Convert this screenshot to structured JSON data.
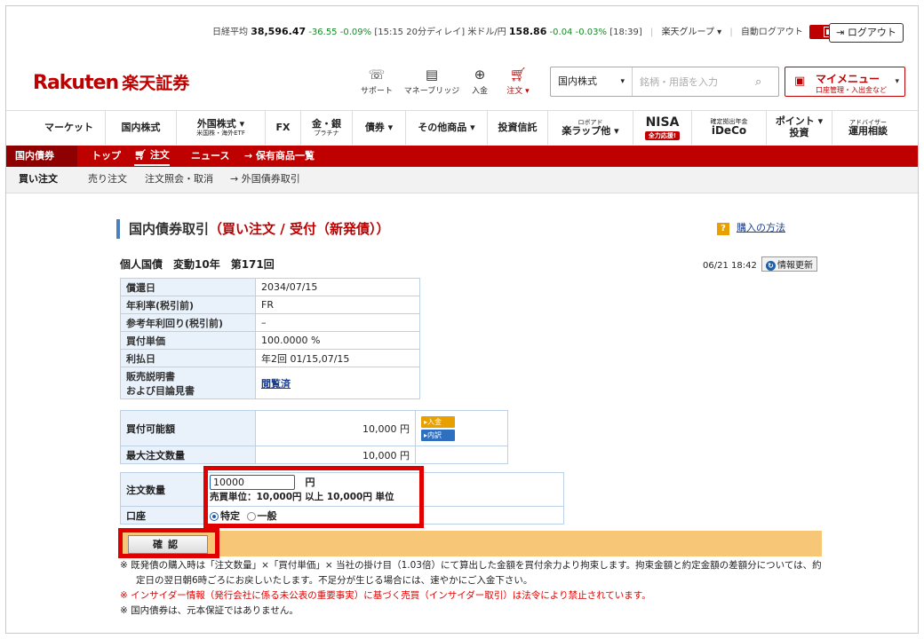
{
  "ticker": {
    "nikkei_label": "日経平均",
    "nikkei_value": "38,596.47",
    "nikkei_change": "-36.55",
    "nikkei_pct": "-0.09%",
    "nikkei_time": "[15:15 20分ディレイ]",
    "usd_label": "米ドル/円",
    "usd_value": "158.86",
    "usd_change": "-0.04",
    "usd_pct": "-0.03%",
    "usd_time": "[18:39]",
    "group": "楽天グループ",
    "auto_logout": "自動ログアウト",
    "logout": "ログアウト"
  },
  "header": {
    "logo_en": "Rakuten",
    "logo_jp": "楽天証券",
    "icons": [
      {
        "label": "サポート",
        "icon": "support-icon"
      },
      {
        "label": "マネーブリッジ",
        "icon": "bank-icon"
      },
      {
        "label": "入金",
        "icon": "deposit-icon"
      },
      {
        "label": "注文 ▾",
        "icon": "cart-icon"
      }
    ],
    "search_category": "国内株式",
    "search_placeholder": "銘柄・用語を入力",
    "mymenu_title": "マイメニュー",
    "mymenu_sub": "口座管理・入出金など"
  },
  "gnav": [
    {
      "label": "マーケット",
      "sub": ""
    },
    {
      "label": "国内株式",
      "sub": ""
    },
    {
      "label": "外国株式 ▾",
      "sub": "米国株・海外ETF"
    },
    {
      "label": "FX",
      "sub": ""
    },
    {
      "label": "金・銀",
      "sub": "プラチナ"
    },
    {
      "label": "債券 ▾",
      "sub": ""
    },
    {
      "label": "その他商品 ▾",
      "sub": ""
    },
    {
      "label": "投資信託",
      "sub": ""
    },
    {
      "label": "楽ラップ他 ▾",
      "sub": "ロボアド"
    },
    {
      "label": "NISA",
      "sub": "全力応援!"
    },
    {
      "label": "iDeCo",
      "sub": "確定拠出年金"
    },
    {
      "label": "ポイント ▾",
      "sub": "投資"
    },
    {
      "label": "アドバイザー",
      "sub": "運用相談"
    }
  ],
  "rednav": {
    "current": "国内債券",
    "top": "トップ",
    "order": "注文",
    "news": "ニュース",
    "holdings": "→ 保有商品一覧"
  },
  "subnav": {
    "buy": "買い注文",
    "sell": "売り注文",
    "inquiry": "注文照会・取消",
    "foreign": "→ 外国債券取引"
  },
  "page": {
    "title_main": "国内債券取引",
    "title_red": "（買い注文 / 受付（新発債））",
    "howto_mark": "?",
    "howto": "購入の方法",
    "bond_name": "個人国債　変動10年　第171回",
    "timestamp": "06/21 18:42",
    "refresh": "情報更新"
  },
  "info": [
    {
      "key": "償還日",
      "value": "2034/07/15"
    },
    {
      "key": "年利率(税引前)",
      "value": "FR"
    },
    {
      "key": "参考年利回り(税引前)",
      "value": "–"
    },
    {
      "key": "買付単価",
      "value": "100.0000 %"
    },
    {
      "key": "利払日",
      "value": "年2回 01/15,07/15"
    }
  ],
  "prospectus": {
    "key_line1": "販売説明書",
    "key_line2": "および目論見書",
    "value": "閲覧済"
  },
  "balance": {
    "available_label": "買付可能額",
    "available_value": "10,000 円",
    "deposit_btn": "▸入金",
    "detail_btn": "▸内訳",
    "max_label": "最大注文数量",
    "max_value": "10,000 円"
  },
  "order": {
    "qty_label": "注文数量",
    "qty_value": "10000",
    "qty_unit": "円",
    "unit_note": "売買単位：10,000円 以上 10,000円 単位",
    "account_label": "口座",
    "account_opt1": "特定",
    "account_opt2": "一般",
    "confirm": "確認"
  },
  "notes": [
    "※ 既発債の購入時は「注文数量」×「買付単価」× 当社の掛け目（1.03倍）にて算出した金額を買付余力より拘束します。拘束金額と約定金額の差額分については、約定日の翌日朝6時ごろにお戻しいたします。不足分が生じる場合には、速やかにご入金下さい。",
    "※ インサイダー情報（発行会社に係る未公表の重要事実）に基づく売買（インサイダー取引）は法令により禁止されています。",
    "※ 国内債券は、元本保証ではありません。"
  ],
  "colors": {
    "brand": "#bf0000",
    "highlight": "#e10000",
    "table_key_bg": "#e9f1fb",
    "action_bar": "#f7c777"
  }
}
